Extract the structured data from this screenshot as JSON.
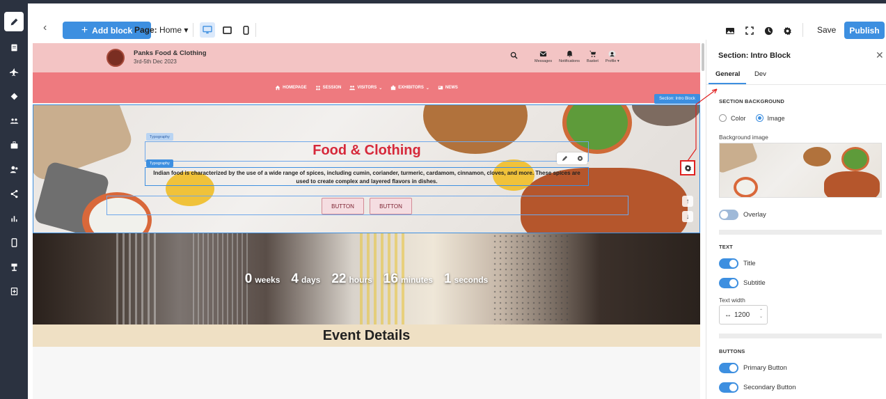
{
  "toolbar": {
    "add_block_label": "Add block",
    "page_label": "Page:",
    "page_value": "Home",
    "save_label": "Save",
    "publish_label": "Publish"
  },
  "site": {
    "brand_name": "Panks Food & Clothing",
    "brand_date": "3rd-5th Dec 2023",
    "header_items": [
      "Messages",
      "Notifications",
      "Basket",
      "Profile"
    ],
    "nav": [
      "HOMEPAGE",
      "SESSION",
      "VISITORS",
      "EXHIBITORS",
      "NEWS"
    ]
  },
  "hero": {
    "section_tag": "Section: Intro Block",
    "typo_label_title": "Typography",
    "typo_label_sub": "Typography",
    "title": "Food & Clothing",
    "subtitle": "Indian food is characterized by the use of a wide range of spices, including cumin, coriander, turmeric, cardamom, cinnamon, cloves, and more. These spices are used to create complex and layered flavors in dishes.",
    "button1": "BUTTON",
    "button2": "BUTTON"
  },
  "countdown": {
    "weeks": "0",
    "weeks_unit": "weeks",
    "days": "4",
    "days_unit": "days",
    "hours": "22",
    "hours_unit": "hours",
    "minutes": "16",
    "minutes_unit": "minutes",
    "seconds": "1",
    "seconds_unit": "seconds"
  },
  "event_details": "Event Details",
  "panel": {
    "title": "Section: Intro Block",
    "tab_general": "General",
    "tab_dev": "Dev",
    "section_background": "SECTION BACKGROUND",
    "radio_color": "Color",
    "radio_image": "Image",
    "background_image_label": "Background image",
    "overlay_label": "Overlay",
    "text_heading": "TEXT",
    "title_toggle": "Title",
    "subtitle_toggle": "Subtitle",
    "text_width_label": "Text width",
    "text_width_value": "1200",
    "buttons_heading": "BUTTONS",
    "primary_button": "Primary Button",
    "secondary_button": "Secondary Button"
  },
  "colors": {
    "accent": "#3d8fe0",
    "rail": "#2b3240",
    "header_pink": "#f3c4c4",
    "nav_red": "#ee7a7f",
    "title_red": "#d6283a",
    "highlight_red": "#e02020"
  }
}
